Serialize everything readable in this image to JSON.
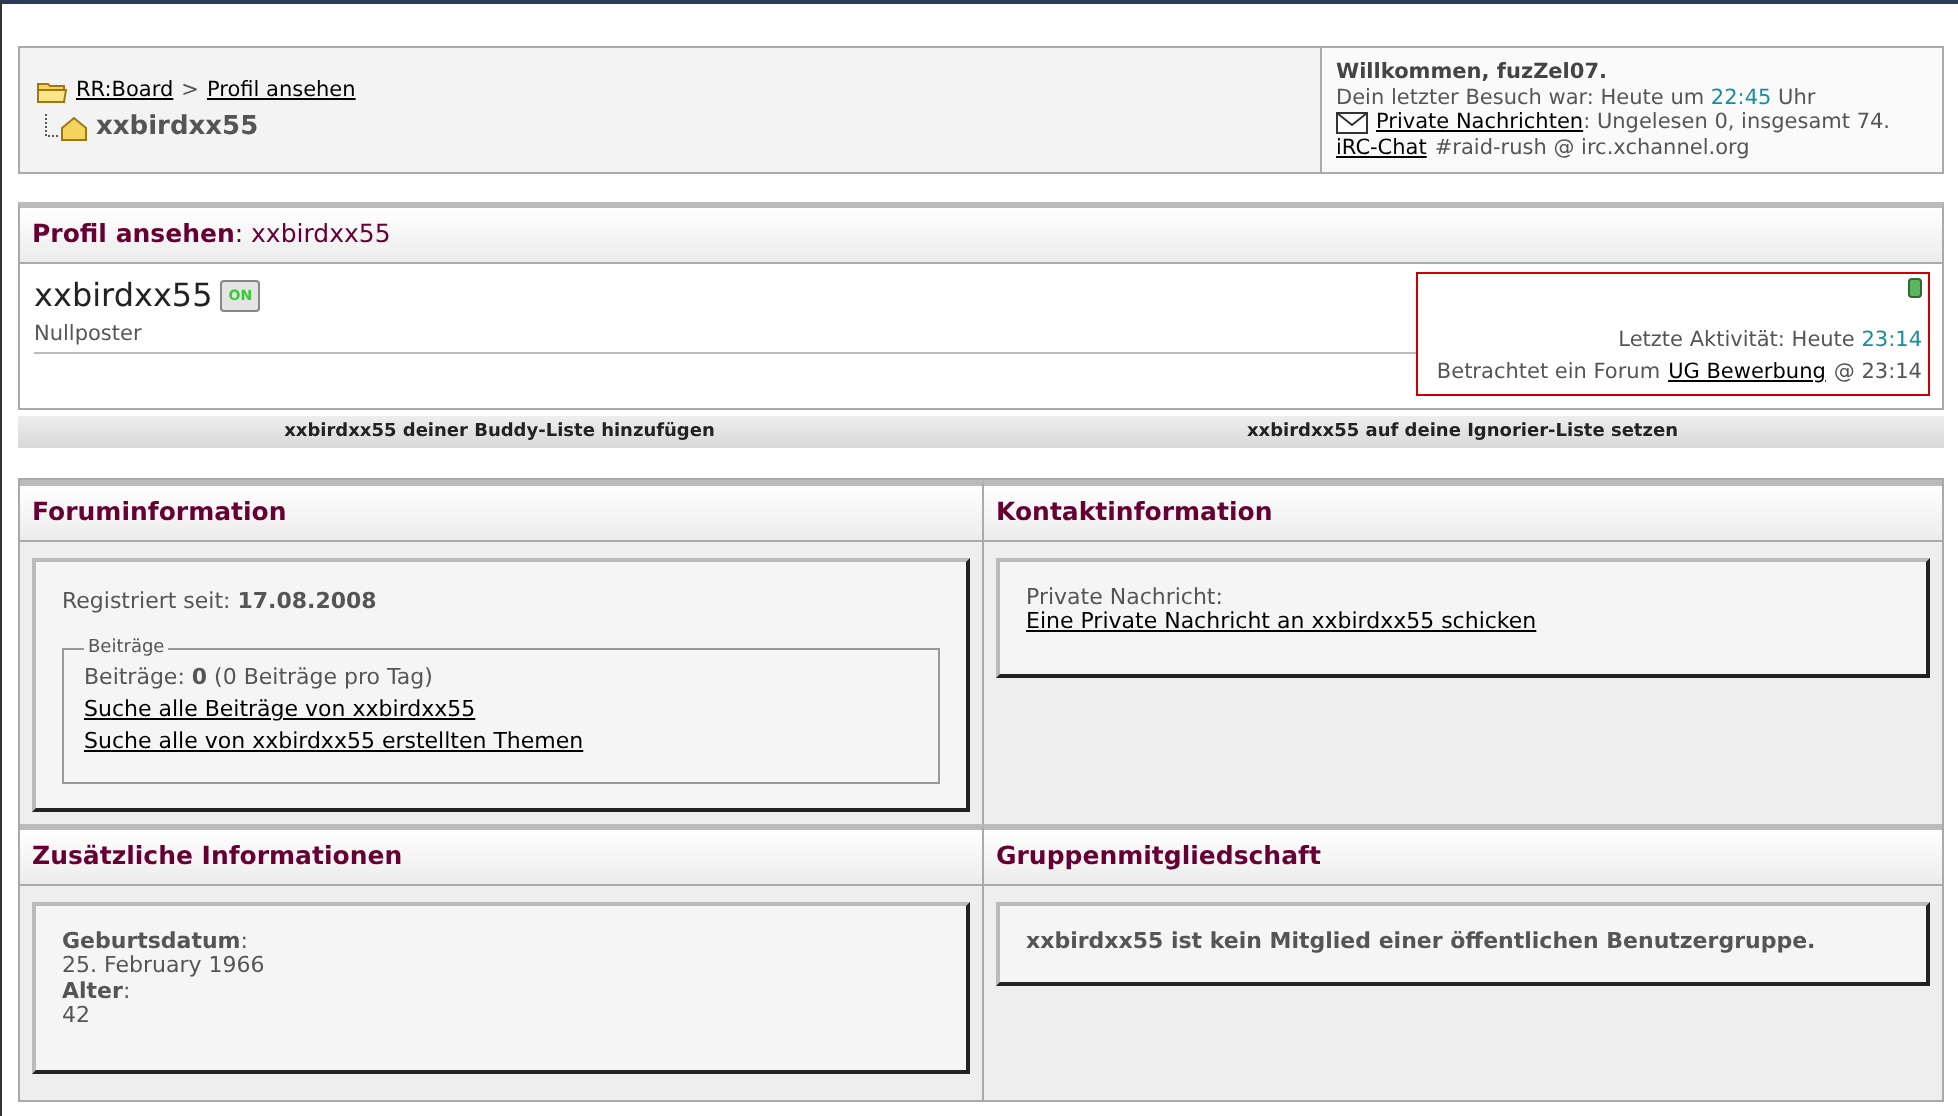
{
  "navbar": {
    "breadcrumb": [
      {
        "label": "RR:Board"
      },
      {
        "label": "Profil ansehen"
      }
    ],
    "separator": ">",
    "current": "xxbirdxx55",
    "welcome": "Willkommen, fuzZel07.",
    "last_visit": {
      "label": "Dein letzter Besuch war: Heute um",
      "time": "22:45",
      "suffix": "Uhr"
    },
    "pm": {
      "link": "Private Nachrichten",
      "text": ": Ungelesen 0, insgesamt 74."
    },
    "irc": {
      "link": "iRC-Chat",
      "text": "#raid-rush @ irc.xchannel.org"
    }
  },
  "profile": {
    "title": "**Profil ansehen**: xxbirdxx55",
    "username": "xxbirdxx55",
    "online": true,
    "badge": "ON",
    "rank": "Nullposter",
    "last_activity": {
      "label": "Letzte Aktivität: Heute",
      "time": "23:14"
    },
    "viewing": {
      "label": "Betrachtet ein Forum",
      "link": "UG Bewerbung",
      "suffix": "@ 23:14"
    }
  },
  "actions": [
    "xxbirdxx55 deiner Buddy-Liste hinzufügen",
    "xxbirdxx55 auf deine Ignorier-Liste setzen"
  ],
  "panels": [
    {
      "title": "Foruminformation",
      "kind": "forum",
      "registered": "Registriert seit: **17.08.2008**",
      "legend": "Beiträge",
      "posts": "Beiträge: **0** (0 Beiträge pro Tag)",
      "links": [
        "Suche alle Beiträge von xxbirdxx55",
        "Suche alle von xxbirdxx55 erstellten Themen"
      ]
    },
    {
      "title": "Kontaktinformation",
      "kind": "contact",
      "label": "Private Nachricht:",
      "link": "Eine Private Nachricht an xxbirdxx55 schicken"
    },
    {
      "title": "Zusätzliche Informationen",
      "kind": "fields",
      "fields": [
        {
          "label": "**Geburtsdatum**:",
          "value": "25. February 1966"
        },
        {
          "label": "**Alter**:",
          "value": "42"
        }
      ]
    },
    {
      "title": "Gruppenmitgliedschaft",
      "kind": "text",
      "text": "xxbirdxx55 ist kein Mitglied einer öffentlichen Benutzergruppe."
    }
  ]
}
